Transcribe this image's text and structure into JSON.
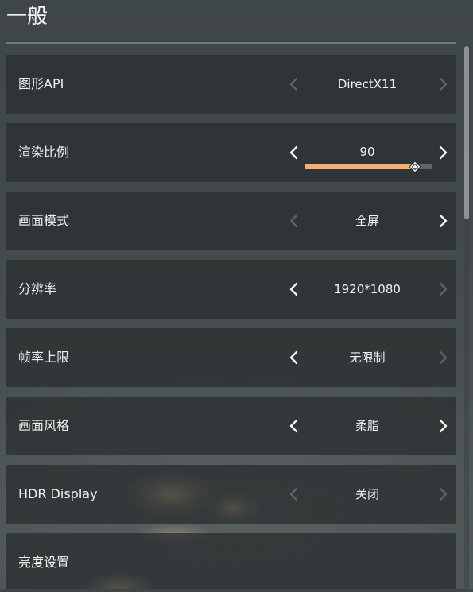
{
  "section": {
    "title": "一般"
  },
  "settings": [
    {
      "label": "图形API",
      "value": "DirectX11",
      "left_enabled": false,
      "right_enabled": false
    },
    {
      "label": "渲染比例",
      "value": "90",
      "left_enabled": true,
      "right_enabled": true,
      "slider": {
        "fraction": 0.86
      }
    },
    {
      "label": "画面模式",
      "value": "全屏",
      "left_enabled": false,
      "right_enabled": true
    },
    {
      "label": "分辨率",
      "value": "1920*1080",
      "left_enabled": true,
      "right_enabled": false
    },
    {
      "label": "帧率上限",
      "value": "无限制",
      "left_enabled": true,
      "right_enabled": false
    },
    {
      "label": "画面风格",
      "value": "柔脂",
      "left_enabled": true,
      "right_enabled": true
    },
    {
      "label": "HDR Display",
      "value": "关闭",
      "left_enabled": false,
      "right_enabled": false
    },
    {
      "label": "亮度设置"
    }
  ],
  "icons": {
    "left": "chevron-left-icon",
    "right": "chevron-right-icon",
    "slider_thumb": "diamond-handle-icon"
  },
  "colors": {
    "slider_fill": "#ecae83",
    "arrow_enabled": "#f4f5f5",
    "arrow_disabled": "#5c6364",
    "row_background": "#2a2f31"
  },
  "scroll": {
    "position_fraction": 0.0
  }
}
